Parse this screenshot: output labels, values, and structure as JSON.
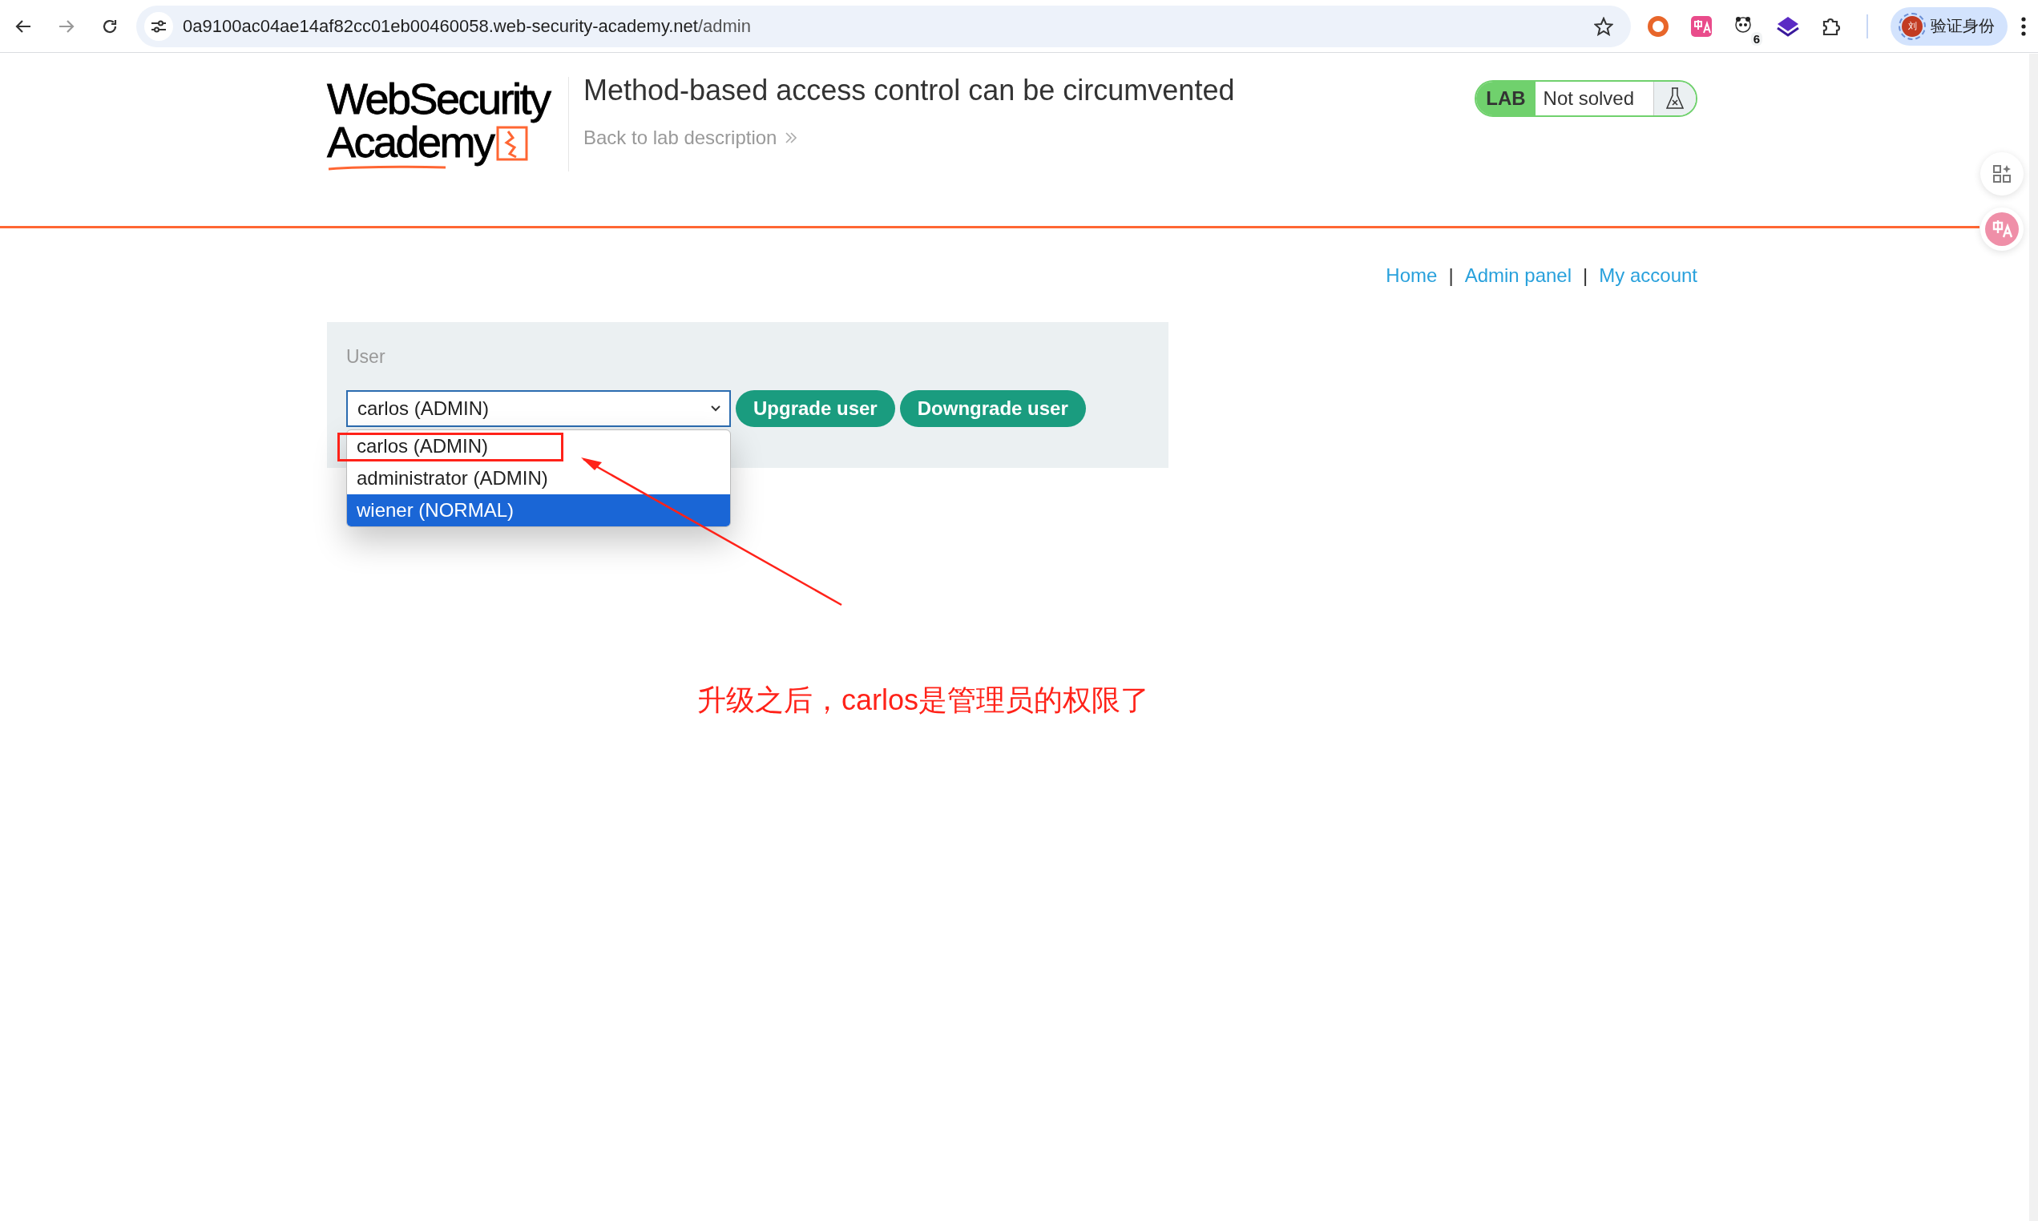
{
  "browser": {
    "url_host": "0a9100ac04ae14af82cc01eb00460058.web-security-academy.net",
    "url_path": "/admin",
    "extension_badge": "6",
    "profile_avatar": "刘",
    "profile_label": "验证身份"
  },
  "header": {
    "logo_lines": [
      "WebSecurity",
      "Academy"
    ],
    "title": "Method-based access control can be circumvented",
    "back_link": "Back to lab description",
    "lab_badge": {
      "label": "LAB",
      "status": "Not solved",
      "solved": false
    }
  },
  "nav": [
    {
      "kind": "link",
      "text": "Home"
    },
    {
      "kind": "separator",
      "text": "|"
    },
    {
      "kind": "link",
      "text": "Admin panel"
    },
    {
      "kind": "separator",
      "text": "|"
    },
    {
      "kind": "link",
      "text": "My account"
    }
  ],
  "form": {
    "label": "User",
    "select_value": "carlos (ADMIN)",
    "options": [
      {
        "label": "carlos (ADMIN)",
        "selected": false
      },
      {
        "label": "administrator (ADMIN)",
        "selected": false
      },
      {
        "label": "wiener (NORMAL)",
        "selected": true
      }
    ],
    "buttons": [
      "Upgrade user",
      "Downgrade user"
    ]
  },
  "annotation": {
    "note": "升级之后，carlos是管理员的权限了"
  }
}
